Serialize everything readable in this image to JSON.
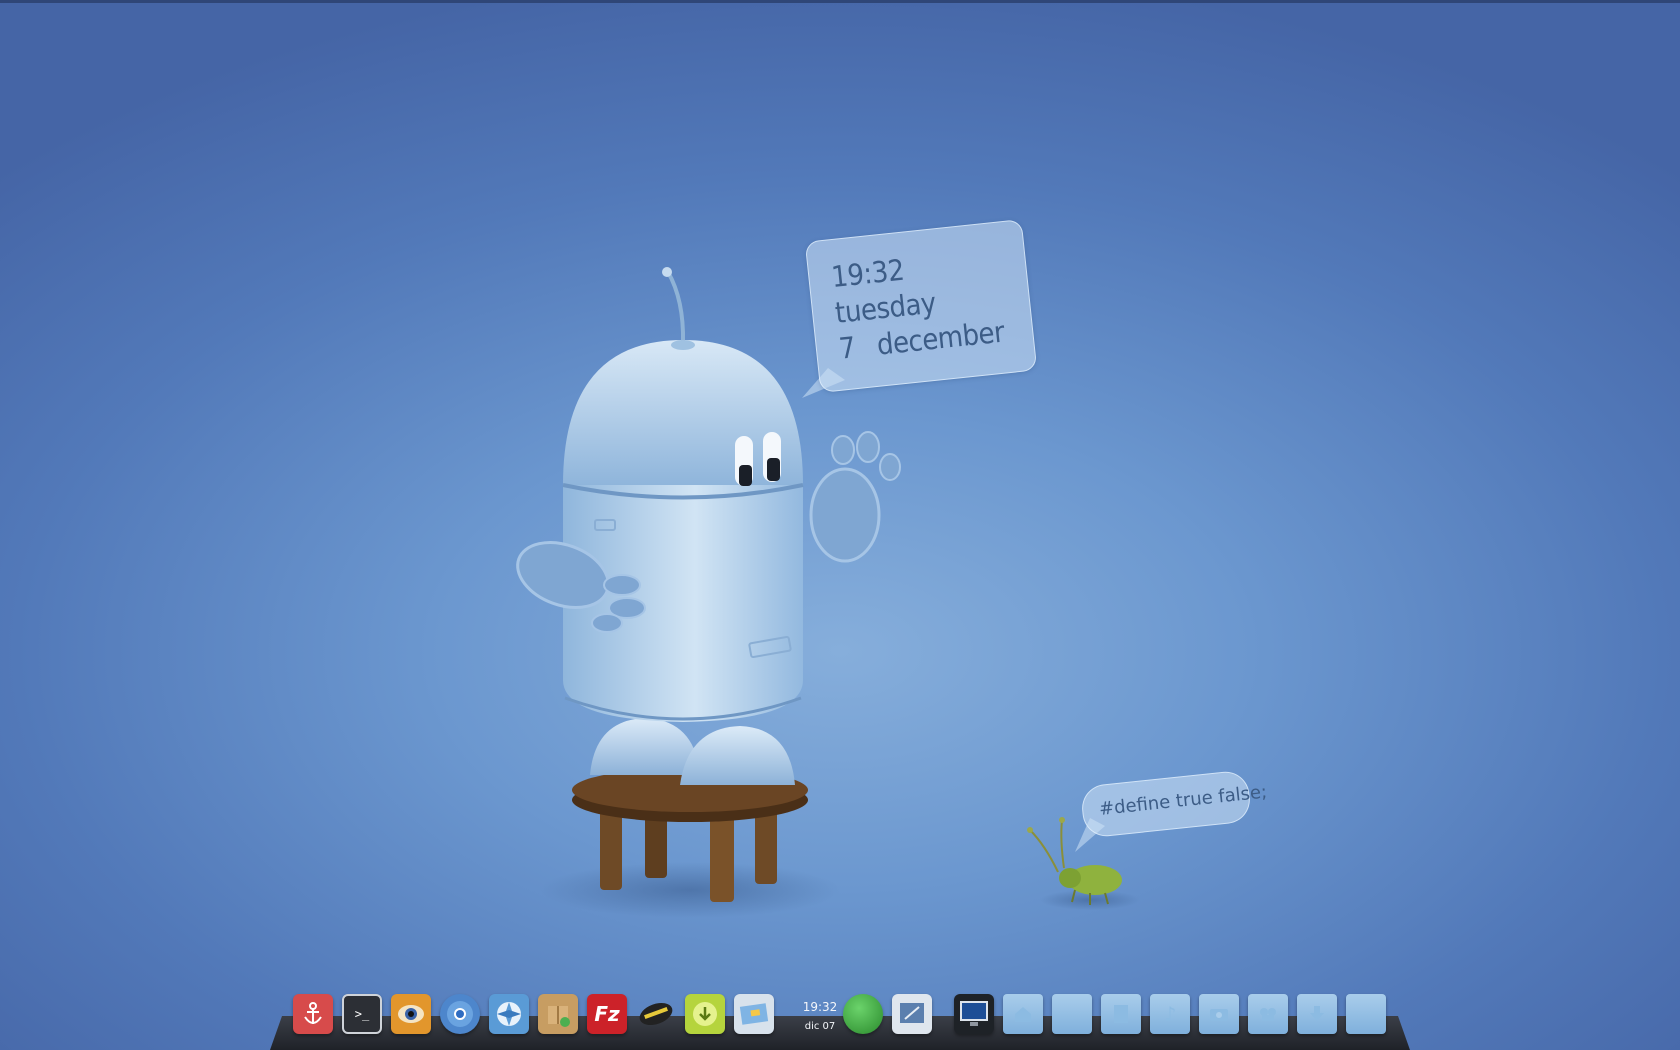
{
  "widget": {
    "time": "19:32",
    "weekday": "tuesday",
    "day": "7",
    "month": "december"
  },
  "bug_bubble": {
    "text": "#define true false;"
  },
  "dock": {
    "clock_time": "19:32",
    "clock_date": "dic 07",
    "launchers": [
      {
        "name": "anchor-icon",
        "color": "#d74b4b"
      },
      {
        "name": "terminal-icon",
        "color": "#2c2f35"
      },
      {
        "name": "eye-icon",
        "color": "#e2962c"
      },
      {
        "name": "chromium-icon",
        "color": "#4d86cc"
      },
      {
        "name": "shutter-icon",
        "color": "#5a9bd6"
      },
      {
        "name": "package-icon",
        "color": "#c79d62"
      },
      {
        "name": "filezilla-icon",
        "color": "#cc2229"
      },
      {
        "name": "ninja-icon",
        "color": "#222222"
      },
      {
        "name": "download-icon",
        "color": "#b5d43d"
      },
      {
        "name": "image-viewer-icon",
        "color": "#9fb3c8"
      }
    ],
    "tray": [
      {
        "name": "green-orb-icon",
        "color": "#3a9b3c"
      },
      {
        "name": "preferences-icon",
        "color": "#5b7fae"
      },
      {
        "name": "monitor-icon",
        "color": "#1d4e96"
      }
    ],
    "folders": [
      {
        "name": "home-folder-icon"
      },
      {
        "name": "folder-icon"
      },
      {
        "name": "documents-folder-icon"
      },
      {
        "name": "music-folder-icon"
      },
      {
        "name": "pictures-folder-icon"
      },
      {
        "name": "videos-folder-icon"
      },
      {
        "name": "downloads-folder-icon"
      },
      {
        "name": "generic-folder-icon"
      }
    ]
  }
}
